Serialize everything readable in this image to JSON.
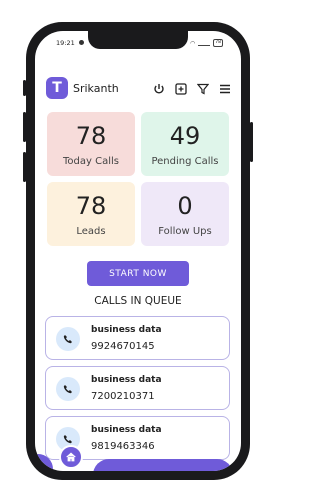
{
  "status": {
    "time": "19:21",
    "battery": "78"
  },
  "header": {
    "title": "Srikanth",
    "logo_letter": "T"
  },
  "cards": [
    {
      "value": "78",
      "label": "Today Calls",
      "color": "#f7dcda"
    },
    {
      "value": "49",
      "label": "Pending Calls",
      "color": "#dff5ea"
    },
    {
      "value": "78",
      "label": "Leads",
      "color": "#fdf1dd"
    },
    {
      "value": "0",
      "label": "Follow Ups",
      "color": "#efe8f8"
    }
  ],
  "start_button": "START NOW",
  "queue_title": "CALLS IN QUEUE",
  "queue": [
    {
      "name": "business data",
      "phone": "9924670145"
    },
    {
      "name": "business data",
      "phone": "7200210371"
    },
    {
      "name": "business data",
      "phone": "9819463346"
    }
  ],
  "accent": "#6f5bd9"
}
